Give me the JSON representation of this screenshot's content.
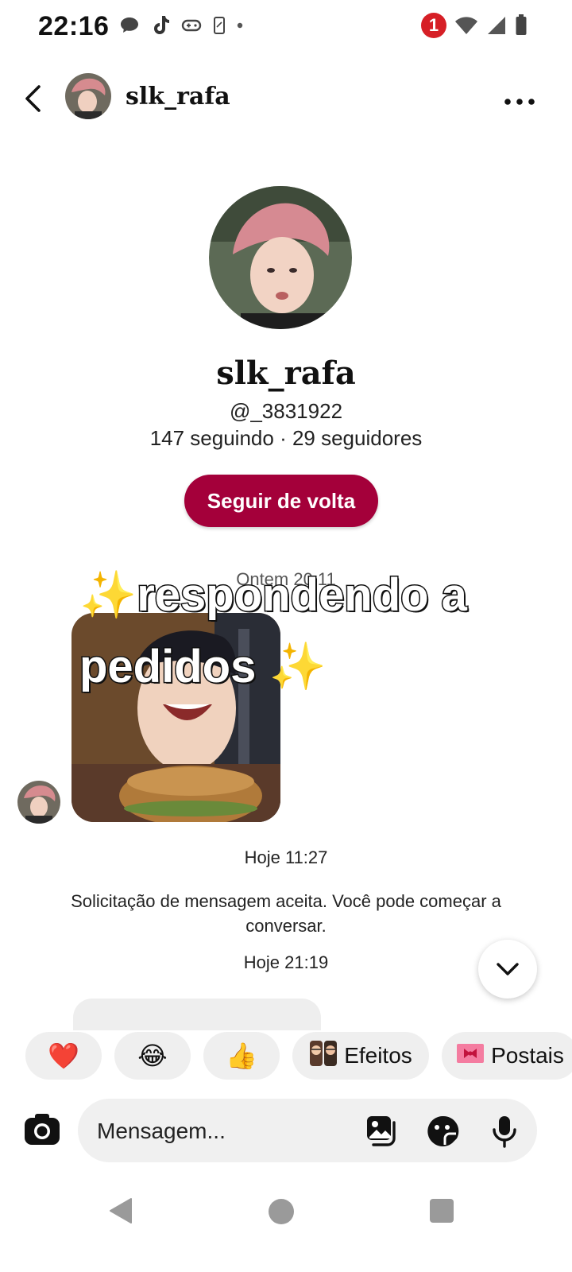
{
  "status_bar": {
    "time": "22:16",
    "notification_count": "1",
    "icons": [
      "chat-bubble-icon",
      "tiktok-icon",
      "gamepad-icon",
      "phone-icon",
      "dot-icon",
      "wifi-icon",
      "signal-icon",
      "battery-icon"
    ]
  },
  "header": {
    "username": "slk_rafa"
  },
  "profile": {
    "display_name": "slk_rafa",
    "handle": "@_3831922",
    "stats": "147 seguindo · 29 seguidores",
    "follow_button": "Seguir de volta"
  },
  "chat": {
    "timestamp_yesterday": "Ontem 20:11",
    "image_caption": "respondendo a pedidos",
    "timestamp_today_1": "Hoje 11:27",
    "system_message": "Solicitação de mensagem aceita. Você pode começar a conversar.",
    "timestamp_today_2": "Hoje 21:19"
  },
  "quick_reactions": {
    "emojis": [
      "❤️",
      "😂",
      "👍"
    ],
    "effects_label": "Efeitos",
    "postcards_label": "Postais"
  },
  "composer": {
    "placeholder": "Mensagem..."
  },
  "colors": {
    "follow_button": "#a4003a",
    "chip_background": "#efefef",
    "composer_background": "#f0f0f0"
  }
}
